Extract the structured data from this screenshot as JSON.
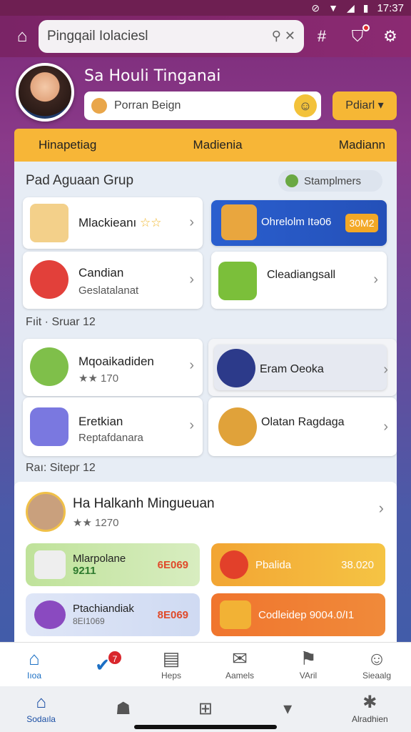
{
  "status_bar": {
    "time": "17:37"
  },
  "search": {
    "value": "Pingqail Iolaciesl"
  },
  "profile": {
    "name": "Sa Houli Tinganai",
    "field_value": "Porran Beign",
    "dropdown_label": "Pdiarl"
  },
  "tabs": [
    "Hinapetiag",
    "Madienia",
    "Madiann"
  ],
  "section1": {
    "title": "Pad Aguaan Grup",
    "pill_label": "Stamplmers",
    "cards": [
      {
        "title": "Mlackieanı",
        "stars": "☆☆",
        "subtitle": ""
      },
      {
        "title": "Ohrelolm Itə06",
        "badge": "30M2"
      },
      {
        "title": "Candian",
        "subtitle": "Geslatalanat"
      },
      {
        "title": "Cleadiangsall",
        "subtitle": ""
      }
    ]
  },
  "section2": {
    "title": "Fıit · Sruar  12",
    "cards": [
      {
        "title": "Mqoaikadiden",
        "subtitle": "★★ 170"
      },
      {
        "title": "Eram Oeoka",
        "subtitle": ""
      },
      {
        "title": "Eretkian",
        "subtitle": "Reptafdanara"
      },
      {
        "title": "Olatan Ragdaga",
        "subtitle": ""
      }
    ]
  },
  "section3": {
    "title": "Raı: Sitepr  12",
    "big_card": {
      "title": "Ha Halkanh Mingueuan",
      "subtitle": "★★ 1270"
    },
    "promos": [
      {
        "title": "Mlarpolane",
        "subtitle": "9211",
        "value": "6E069"
      },
      {
        "title": "Pbalida",
        "value": "38.020"
      },
      {
        "title": "Ptachiandiak",
        "subtitle": "8EI1069",
        "value": "8E069"
      },
      {
        "title": "Codleidep 9004.0/I1",
        "value": ""
      }
    ]
  },
  "app_nav": [
    {
      "label": "Iıoa",
      "icon": "home-icon",
      "active": true
    },
    {
      "label": "",
      "icon": "badge-check-icon",
      "badge": "7"
    },
    {
      "label": "Heps",
      "icon": "document-icon"
    },
    {
      "label": "Aamels",
      "icon": "mail-icon"
    },
    {
      "label": "VAril",
      "icon": "bookmark-icon"
    },
    {
      "label": "Sieaalg",
      "icon": "user-icon"
    }
  ],
  "sys_nav": [
    {
      "label": "Sodaıla",
      "icon": "home-icon",
      "active": true
    },
    {
      "label": "",
      "icon": "bag-icon"
    },
    {
      "label": "",
      "icon": "plus-icon"
    },
    {
      "label": "",
      "icon": "message-icon"
    },
    {
      "label": "Alradhien",
      "icon": "settings-icon"
    }
  ],
  "colors": {
    "accent": "#f7b637",
    "primary": "#1b6fc4",
    "header": "#7a2466"
  }
}
